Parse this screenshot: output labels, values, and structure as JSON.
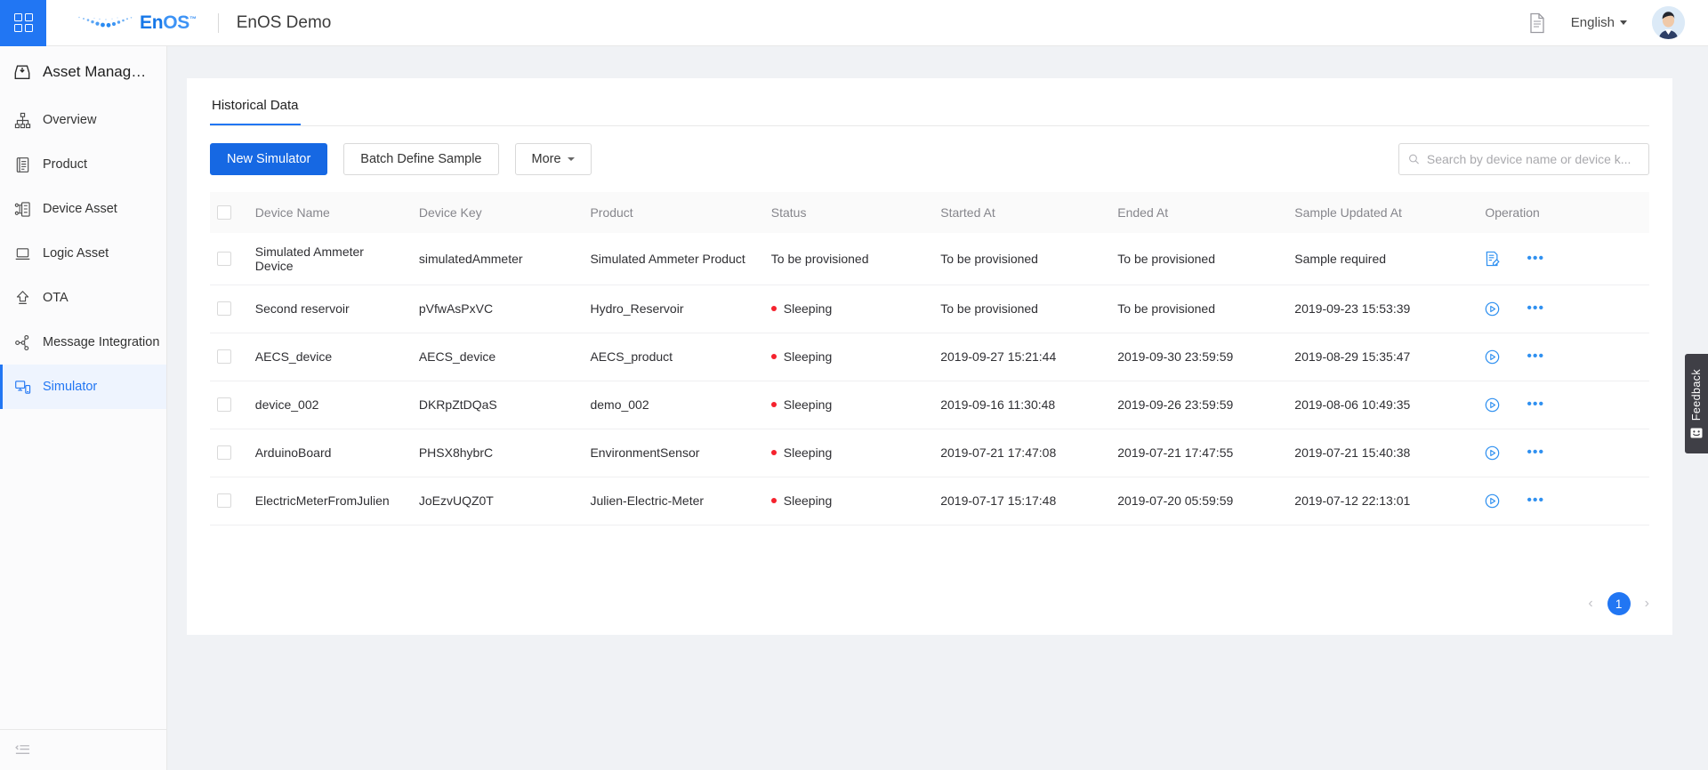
{
  "header": {
    "grid_icon": "app-grid-icon",
    "logo_text_primary": "En",
    "logo_text_secondary": "OS",
    "logo_tm": "™",
    "app_title": "EnOS Demo",
    "doc_icon": "document-icon",
    "language": "English",
    "avatar": "user-avatar"
  },
  "sidebar": {
    "title": "Asset Manag…",
    "title_icon": "asset-management-icon",
    "collapse_icon": "collapse-sidebar-icon",
    "items": [
      {
        "label": "Overview",
        "icon": "hierarchy-icon",
        "active": false
      },
      {
        "label": "Product",
        "icon": "document-list-icon",
        "active": false
      },
      {
        "label": "Device Asset",
        "icon": "device-tree-icon",
        "active": false
      },
      {
        "label": "Logic Asset",
        "icon": "laptop-icon",
        "active": false
      },
      {
        "label": "OTA",
        "icon": "upload-arrow-icon",
        "active": false
      },
      {
        "label": "Message Integration",
        "icon": "share-nodes-icon",
        "active": false
      },
      {
        "label": "Simulator",
        "icon": "simulator-icon",
        "active": true
      }
    ]
  },
  "main": {
    "tab": "Historical Data",
    "toolbar": {
      "new_simulator": "New Simulator",
      "batch_define_sample": "Batch Define Sample",
      "more": "More"
    },
    "search": {
      "placeholder": "Search by device name or device k...",
      "value": "",
      "icon": "search-icon"
    },
    "table": {
      "headers": [
        "Device Name",
        "Device Key",
        "Product",
        "Status",
        "Started At",
        "Ended At",
        "Sample Updated At",
        "Operation"
      ],
      "rows": [
        {
          "device_name": "Simulated Ammeter Device",
          "device_key": "simulatedAmmeter",
          "product": "Simulated Ammeter Product",
          "status": "To be provisioned",
          "status_dot": false,
          "started_at": "To be provisioned",
          "ended_at": "To be provisioned",
          "sample_updated_at": "Sample required",
          "op_icon": "edit-document-icon",
          "op_more": "more-options-icon"
        },
        {
          "device_name": "Second reservoir",
          "device_key": "pVfwAsPxVC",
          "product": "Hydro_Reservoir",
          "status": "Sleeping",
          "status_dot": true,
          "started_at": "To be provisioned",
          "ended_at": "To be provisioned",
          "sample_updated_at": "2019-09-23 15:53:39",
          "op_icon": "play-circle-icon",
          "op_more": "more-options-icon"
        },
        {
          "device_name": "AECS_device",
          "device_key": "AECS_device",
          "product": "AECS_product",
          "status": "Sleeping",
          "status_dot": true,
          "started_at": "2019-09-27 15:21:44",
          "ended_at": "2019-09-30 23:59:59",
          "sample_updated_at": "2019-08-29 15:35:47",
          "op_icon": "play-circle-icon",
          "op_more": "more-options-icon"
        },
        {
          "device_name": "device_002",
          "device_key": "DKRpZtDQaS",
          "product": "demo_002",
          "status": "Sleeping",
          "status_dot": true,
          "started_at": "2019-09-16 11:30:48",
          "ended_at": "2019-09-26 23:59:59",
          "sample_updated_at": "2019-08-06 10:49:35",
          "op_icon": "play-circle-icon",
          "op_more": "more-options-icon"
        },
        {
          "device_name": "ArduinoBoard",
          "device_key": "PHSX8hybrC",
          "product": "EnvironmentSensor",
          "status": "Sleeping",
          "status_dot": true,
          "started_at": "2019-07-21 17:47:08",
          "ended_at": "2019-07-21 17:47:55",
          "sample_updated_at": "2019-07-21 15:40:38",
          "op_icon": "play-circle-icon",
          "op_more": "more-options-icon"
        },
        {
          "device_name": "ElectricMeterFromJulien",
          "device_key": "JoEzvUQZ0T",
          "product": "Julien-Electric-Meter",
          "status": "Sleeping",
          "status_dot": true,
          "started_at": "2019-07-17 15:17:48",
          "ended_at": "2019-07-20 05:59:59",
          "sample_updated_at": "2019-07-12 22:13:01",
          "op_icon": "play-circle-icon",
          "op_more": "more-options-icon"
        }
      ]
    },
    "pagination": {
      "prev": "‹",
      "current_page": "1",
      "next": "›"
    }
  },
  "feedback": {
    "label": "Feedback",
    "icon": "smiley-face-icon"
  },
  "colors": {
    "accent": "#2176f3",
    "primary_button": "#1668e3",
    "status_dot": "#f5222d",
    "page_background": "#f0f2f5"
  }
}
